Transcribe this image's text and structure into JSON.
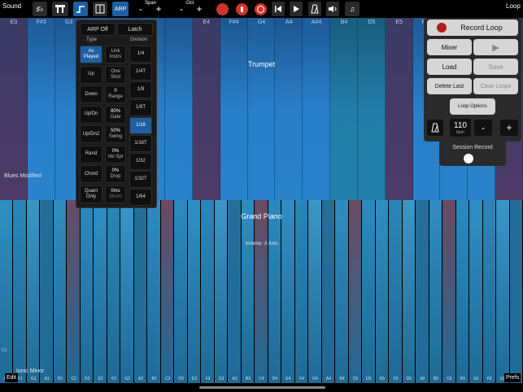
{
  "toolbar": {
    "sound_label": "Sound",
    "arp_label": "ARP",
    "span_label": "Span",
    "oct_label": "Oct",
    "minus": "-",
    "plus": "+",
    "loop_label": "Loop"
  },
  "upper_instrument": {
    "name": "Trumpet",
    "scale": "Blues Modified",
    "keys": [
      "E3",
      "F#3",
      "G3",
      "",
      "",
      "",
      "",
      "E4",
      "F#4",
      "G4",
      "A4",
      "A#4",
      "B4",
      "D5",
      "E5",
      "F#5",
      "G5",
      "A5",
      ""
    ]
  },
  "lower_instrument": {
    "name": "Grand Piano",
    "subtitle": "Volume: X Axis",
    "scale": "Ionic Minor",
    "octave_label": "C1",
    "keys": [
      "E1",
      "F1",
      "G1",
      "A1",
      "B1",
      "C2",
      "D2",
      "E2",
      "F2",
      "G2",
      "A2",
      "B2",
      "C3",
      "D3",
      "E3",
      "F3",
      "G3",
      "A3",
      "B3",
      "C4",
      "D4",
      "E4",
      "F4",
      "G4",
      "A4",
      "B4",
      "C5",
      "D5",
      "E5",
      "F5",
      "G5",
      "A5",
      "B5",
      "C6",
      "D6",
      "E6",
      "F6",
      "G6",
      "A6"
    ]
  },
  "arp_panel": {
    "arp_off": "ARP Off",
    "latch": "Latch",
    "type_header": "Type",
    "division_header": "Division",
    "types": [
      "As Played",
      "Up",
      "Down",
      "Up/Dn",
      "Up/Dn2",
      "Rand",
      "Chord",
      "Quant Only"
    ],
    "selected_type": "As Played",
    "options": [
      {
        "label": "Link Instrs"
      },
      {
        "label": "One Shot"
      },
      {
        "value": "0",
        "label": "Range"
      },
      {
        "value": "80%",
        "label": "Gate"
      },
      {
        "value": "50%",
        "label": "Swing"
      },
      {
        "value": "0%",
        "label": "Vel Spr"
      },
      {
        "value": "0%",
        "label": "Drop"
      },
      {
        "value": "0ms",
        "label": "Strum"
      }
    ],
    "divisions": [
      "1/4",
      "1/4T",
      "1/8",
      "1/8T",
      "1/16",
      "1/16T",
      "1/32",
      "1/32T",
      "1/64"
    ],
    "selected_division": "1/16"
  },
  "loop_panel": {
    "record_loop": "Record Loop",
    "mixer": "Mixer",
    "play_icon": "▶",
    "load": "Load",
    "save": "Save",
    "delete_last": "Delete Last",
    "clear_loops": "Clear Loops",
    "loop_options": "Loop Options",
    "bpm_value": "110",
    "bpm_unit": "bpm",
    "minus": "-",
    "plus": "+",
    "session_record": "Session Record"
  },
  "bottom": {
    "edit": "Edit",
    "prefs": "Prefs"
  },
  "colors": {
    "accent_blue": "#1e5fa3",
    "record_red": "#d0332e"
  }
}
